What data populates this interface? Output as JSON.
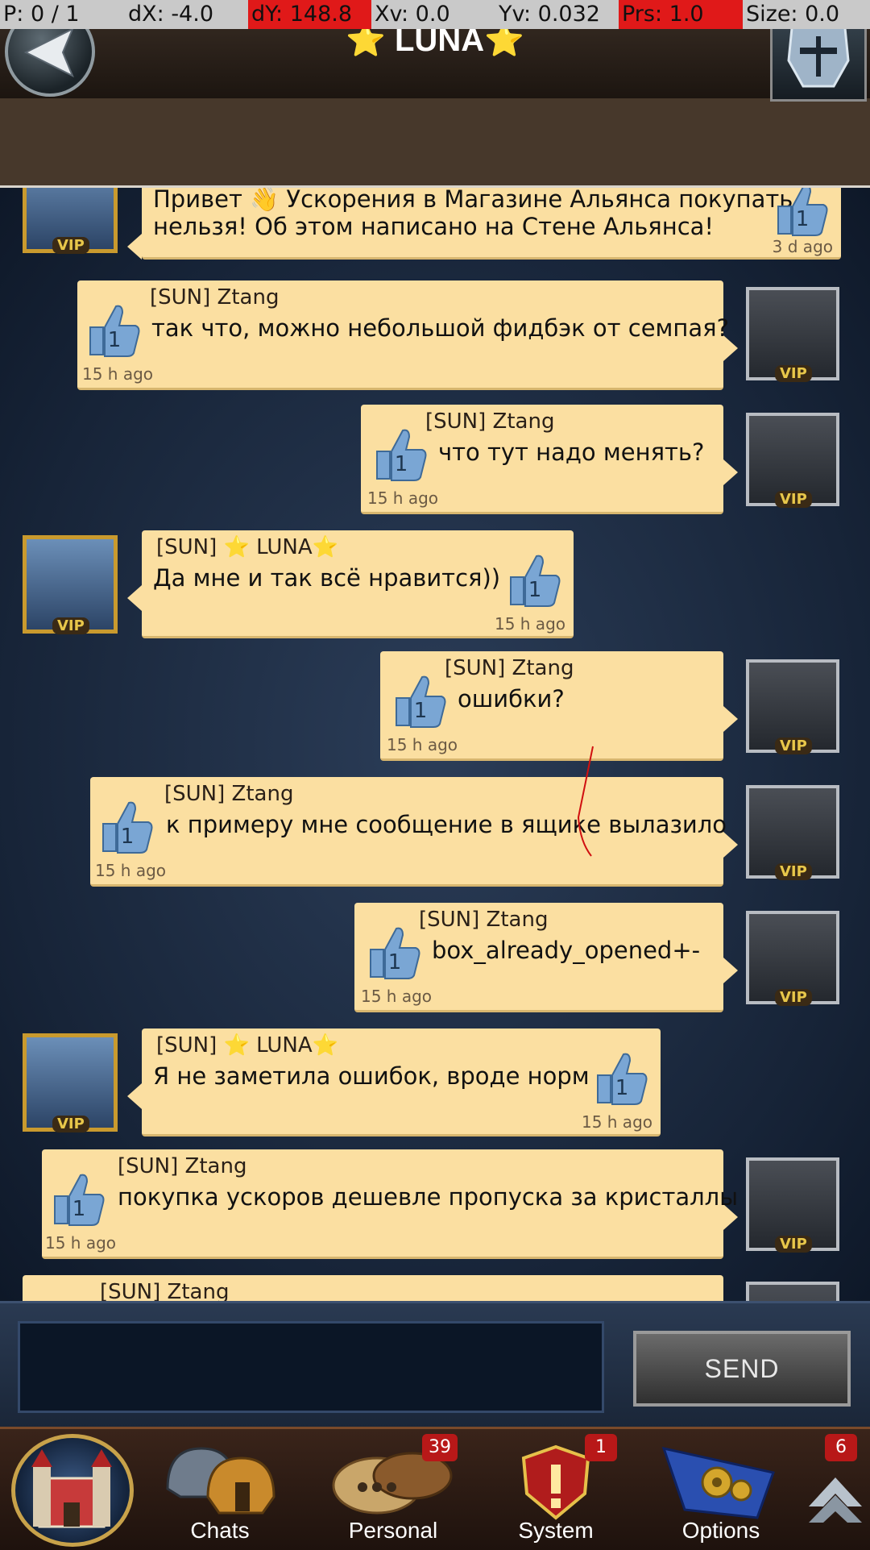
{
  "debug": {
    "pointer": "P: 0 / 1",
    "dx": "dX: -4.0",
    "dy": "dY: 148.8",
    "xv": "Xv: 0.0",
    "yv": "Yv: 0.032",
    "prs": "Prs: 1.0",
    "size": "Size: 0.0"
  },
  "header": {
    "title": "⭐ LUNA⭐"
  },
  "messages": [
    {
      "text1": "Привет 👋 Ускорения в Магазине Альянса покупать",
      "text2": "нельзя! Об этом написано на Стене Альянса!",
      "likes": "1",
      "time": "3 d ago"
    },
    {
      "sender": "[SUN] Ztang",
      "text": "так что, можно небольшой фидбэк от семпая?",
      "likes": "1",
      "time": "15 h ago"
    },
    {
      "sender": "[SUN] Ztang",
      "text": "что тут надо менять?",
      "likes": "1",
      "time": "15 h ago"
    },
    {
      "sender": "[SUN] ⭐ LUNA⭐",
      "text": "Да мне и так всё нравится))",
      "likes": "1",
      "time": "15 h ago"
    },
    {
      "sender": "[SUN] Ztang",
      "text": "ошибки?",
      "likes": "1",
      "time": "15 h ago"
    },
    {
      "sender": "[SUN] Ztang",
      "text": "к примеру мне сообщение в ящике вылазило",
      "likes": "1",
      "time": "15 h ago"
    },
    {
      "sender": "[SUN] Ztang",
      "text": "box_already_opened+-",
      "likes": "1",
      "time": "15 h ago"
    },
    {
      "sender": "[SUN] ⭐ LUNA⭐",
      "text": "Я не заметила ошибок, вроде норм",
      "likes": "1",
      "time": "15 h ago"
    },
    {
      "sender": "[SUN] Ztang",
      "text": "покупка ускоров дешевле пропуска за кристаллы",
      "likes": "1",
      "time": "15 h ago"
    },
    {
      "sender": "[SUN] Ztang"
    }
  ],
  "vip_label": "VIP",
  "composer": {
    "input_value": "",
    "send_label": "SEND"
  },
  "nav": {
    "chats": "Chats",
    "personal": "Personal",
    "personal_badge": "39",
    "system": "System",
    "system_badge": "1",
    "options": "Options",
    "up_badge": "6"
  }
}
